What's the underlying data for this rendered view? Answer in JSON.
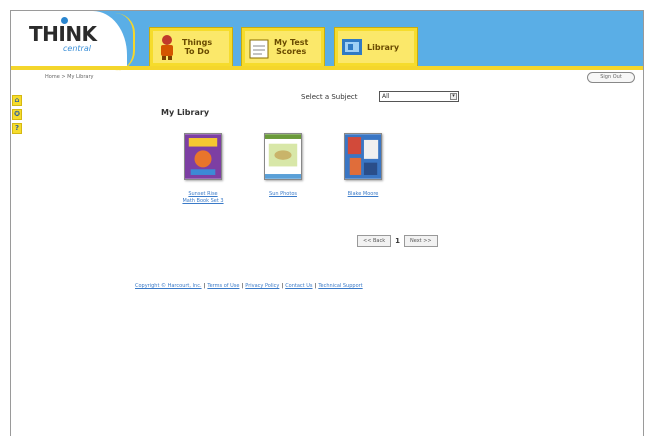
{
  "header": {
    "logo_text": "THINK",
    "logo_sub": "central",
    "tabs": [
      {
        "label_line1": "Things",
        "label_line2": "To Do",
        "icon": "character-icon"
      },
      {
        "label_line1": "My Test",
        "label_line2": "Scores",
        "icon": "clipboard-icon"
      },
      {
        "label_line1": "Library",
        "label_line2": "",
        "icon": "library-icon"
      }
    ]
  },
  "breadcrumb": "Home > My Library",
  "logout_label": "Sign Out",
  "side_icons": [
    "home-icon",
    "settings-icon",
    "help-icon"
  ],
  "side_icon_glyphs": [
    "⌂",
    "✪",
    "?"
  ],
  "main": {
    "title": "My Library",
    "subject_label": "Select a Subject",
    "subject_value": "All"
  },
  "books": [
    {
      "title_line1": "Sunset Rise",
      "title_line2": "Math Book Set 3"
    },
    {
      "title_line1": "Sun Photos",
      "title_line2": ""
    },
    {
      "title_line1": "Blake Moore",
      "title_line2": ""
    }
  ],
  "pager": {
    "back": "<< Back",
    "page": "1",
    "next": "Next >>"
  },
  "footer": {
    "copyright": "Copyright © Harcourt, Inc.",
    "terms": "Terms of Use",
    "privacy": "Privacy Policy",
    "contact": "Contact Us",
    "support": "Technical Support"
  },
  "colors": {
    "header_blue": "#5aaee6",
    "tab_yellow": "#f6dc2c",
    "link_blue": "#3a7ac8"
  }
}
